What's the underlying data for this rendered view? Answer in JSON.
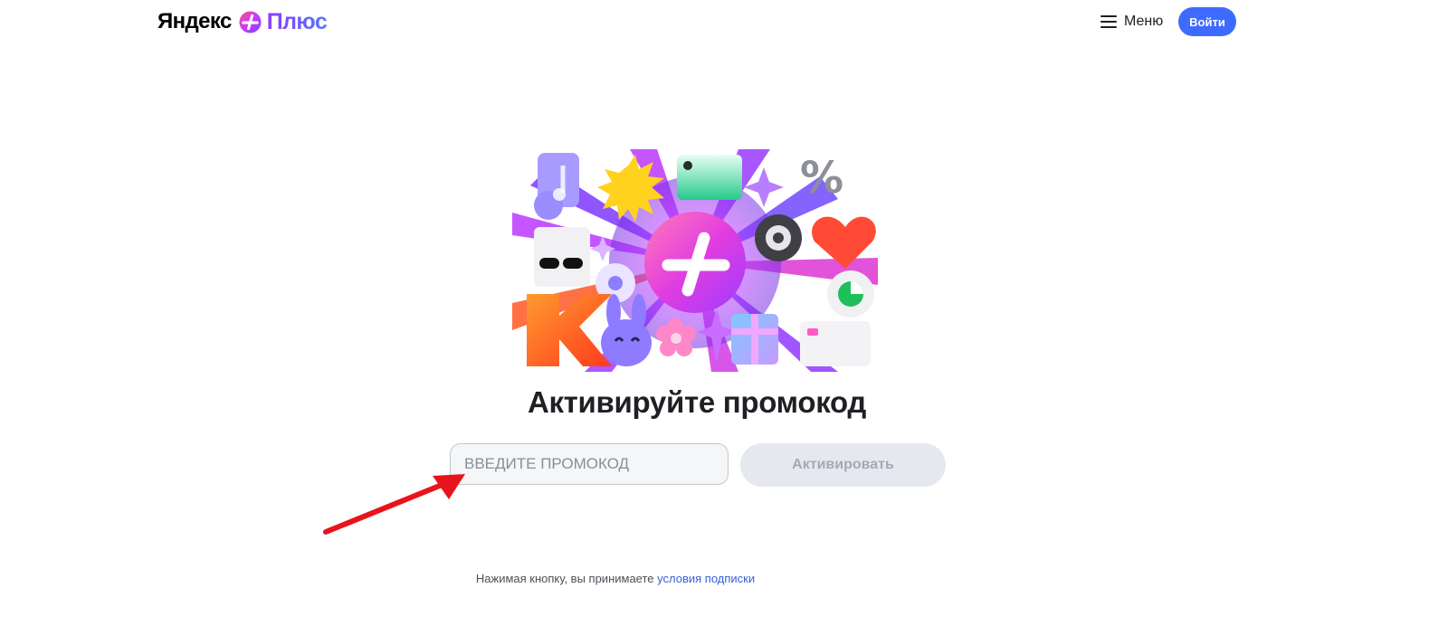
{
  "header": {
    "logo_brand": "Яндекс",
    "logo_product": "Плюс",
    "menu_label": "Меню",
    "login_label": "Войти"
  },
  "main": {
    "title": "Активируйте промокод",
    "promo_input": {
      "value": "",
      "placeholder": "ВВЕДИТЕ ПРОМОКОД"
    },
    "activate_label": "Активировать"
  },
  "footer": {
    "terms_text": "Нажимая кнопку, вы принимаете ",
    "terms_link": "условия подписки"
  },
  "icons": {
    "logo": "yandex-plus-logo-icon",
    "menu": "hamburger-menu-icon",
    "hero": "plus-rewards-illustration"
  },
  "colors": {
    "accent_blue": "#3d6bff",
    "plus_gradient_start": "#ff4f8b",
    "plus_gradient_end": "#8a3ffc",
    "disabled_button_bg": "#e6e8f0",
    "annotation_red": "#e8141b",
    "link": "#3860d8"
  }
}
